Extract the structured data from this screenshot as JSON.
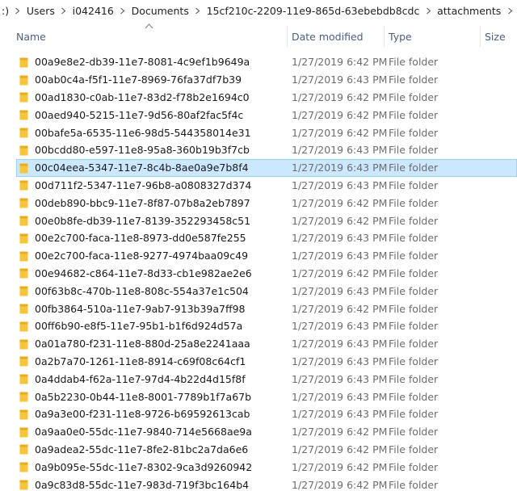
{
  "breadcrumb": {
    "items": [
      ":)",
      "Users",
      "i042416",
      "Documents",
      "15cf210c-2209-11e9-865d-63ebebdb8cdc",
      "attachments"
    ]
  },
  "columns": {
    "name": "Name",
    "date_modified": "Date modified",
    "type": "Type",
    "size": "Size"
  },
  "colors": {
    "selection_bg": "#cce8ff",
    "selection_border": "#99d1ff",
    "folder": "#f5c53a",
    "header_text": "#4d6082"
  },
  "rows": [
    {
      "name": "00a9e8e2-db39-11e7-8081-4c9ef1b9649a",
      "date": "1/27/2019 6:42 PM",
      "type": "File folder"
    },
    {
      "name": "00ab0c4a-f5f1-11e7-8969-76fa37df7b39",
      "date": "1/27/2019 6:43 PM",
      "type": "File folder"
    },
    {
      "name": "00ad1830-c0ab-11e7-83d2-f78b2e1694c0",
      "date": "1/27/2019 6:42 PM",
      "type": "File folder"
    },
    {
      "name": "00aed940-5215-11e7-9d56-80af2fac5f4c",
      "date": "1/27/2019 6:42 PM",
      "type": "File folder"
    },
    {
      "name": "00bafe5a-6535-11e6-98d5-544358014e31",
      "date": "1/27/2019 6:42 PM",
      "type": "File folder"
    },
    {
      "name": "00bcdd80-e597-11e8-95a8-360b19b3f7cb",
      "date": "1/27/2019 6:43 PM",
      "type": "File folder"
    },
    {
      "name": "00c04eea-5347-11e7-8c4b-8ae0a9e7b8f4",
      "date": "1/27/2019 6:43 PM",
      "type": "File folder",
      "selected": true
    },
    {
      "name": "00d711f2-5347-11e7-96b8-a0808327d374",
      "date": "1/27/2019 6:43 PM",
      "type": "File folder"
    },
    {
      "name": "00deb890-bbc9-11e7-8f87-07b8a2eb7897",
      "date": "1/27/2019 6:42 PM",
      "type": "File folder"
    },
    {
      "name": "00e0b8fe-db39-11e7-8139-352293458c51",
      "date": "1/27/2019 6:42 PM",
      "type": "File folder"
    },
    {
      "name": "00e2c700-faca-11e8-8973-dd0e587fe255",
      "date": "1/27/2019 6:43 PM",
      "type": "File folder"
    },
    {
      "name": "00e2c700-faca-11e8-9277-4974baa09c49",
      "date": "1/27/2019 6:43 PM",
      "type": "File folder"
    },
    {
      "name": "00e94682-c864-11e7-8d33-cb1e982ae2e6",
      "date": "1/27/2019 6:42 PM",
      "type": "File folder"
    },
    {
      "name": "00f63b8c-470b-11e8-808c-554a37e1c504",
      "date": "1/27/2019 6:43 PM",
      "type": "File folder"
    },
    {
      "name": "00fb3864-510a-11e7-9ab7-913b39a7ff98",
      "date": "1/27/2019 6:42 PM",
      "type": "File folder"
    },
    {
      "name": "00ff6b90-e8f5-11e7-95b1-b1f6d924d57a",
      "date": "1/27/2019 6:43 PM",
      "type": "File folder"
    },
    {
      "name": "0a01a780-f231-11e8-880d-25a8e2241aaa",
      "date": "1/27/2019 6:43 PM",
      "type": "File folder"
    },
    {
      "name": "0a2b7a70-1261-11e8-8914-c69f08c64cf1",
      "date": "1/27/2019 6:43 PM",
      "type": "File folder"
    },
    {
      "name": "0a4ddab4-f62a-11e7-97d4-4b22d4d15f8f",
      "date": "1/27/2019 6:43 PM",
      "type": "File folder"
    },
    {
      "name": "0a5b2230-0b44-11e8-8001-7789b1f7a67b",
      "date": "1/27/2019 6:43 PM",
      "type": "File folder"
    },
    {
      "name": "0a9a3e00-f231-11e8-9726-b69592613cab",
      "date": "1/27/2019 6:43 PM",
      "type": "File folder"
    },
    {
      "name": "0a9aa0e0-55dc-11e7-9840-714e5668ae9a",
      "date": "1/27/2019 6:42 PM",
      "type": "File folder"
    },
    {
      "name": "0a9adea2-55dc-11e7-8fe2-81bc2a7da6e6",
      "date": "1/27/2019 6:42 PM",
      "type": "File folder"
    },
    {
      "name": "0a9b095e-55dc-11e7-8302-9ca3d9260942",
      "date": "1/27/2019 6:42 PM",
      "type": "File folder"
    },
    {
      "name": "0a9c83d8-55dc-11e7-983d-719f3bc164b4",
      "date": "1/27/2019 6:42 PM",
      "type": "File folder"
    }
  ]
}
